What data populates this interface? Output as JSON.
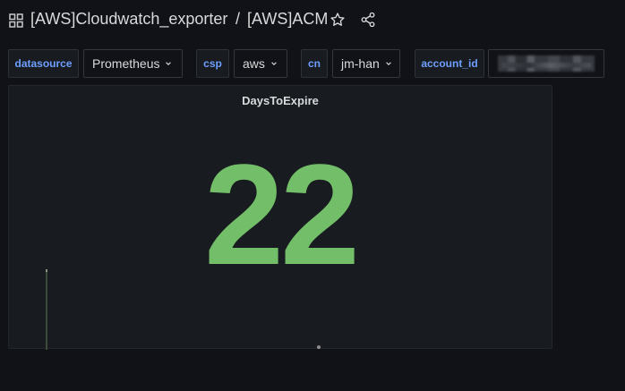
{
  "header": {
    "folder": "[AWS]Cloudwatch_exporter",
    "separator": "/",
    "dashboard": "[AWS]ACM"
  },
  "variables": [
    {
      "label": "datasource",
      "value": "Prometheus"
    },
    {
      "label": "csp",
      "value": "aws"
    },
    {
      "label": "cn",
      "value": "jm-han"
    },
    {
      "label": "account_id",
      "value": ""
    }
  ],
  "panel": {
    "title": "DaysToExpire",
    "value": "22",
    "value_color": "#73bf69"
  },
  "colors": {
    "background": "#111217",
    "panel": "#181b1f",
    "variable_label": "#6e9fff"
  }
}
